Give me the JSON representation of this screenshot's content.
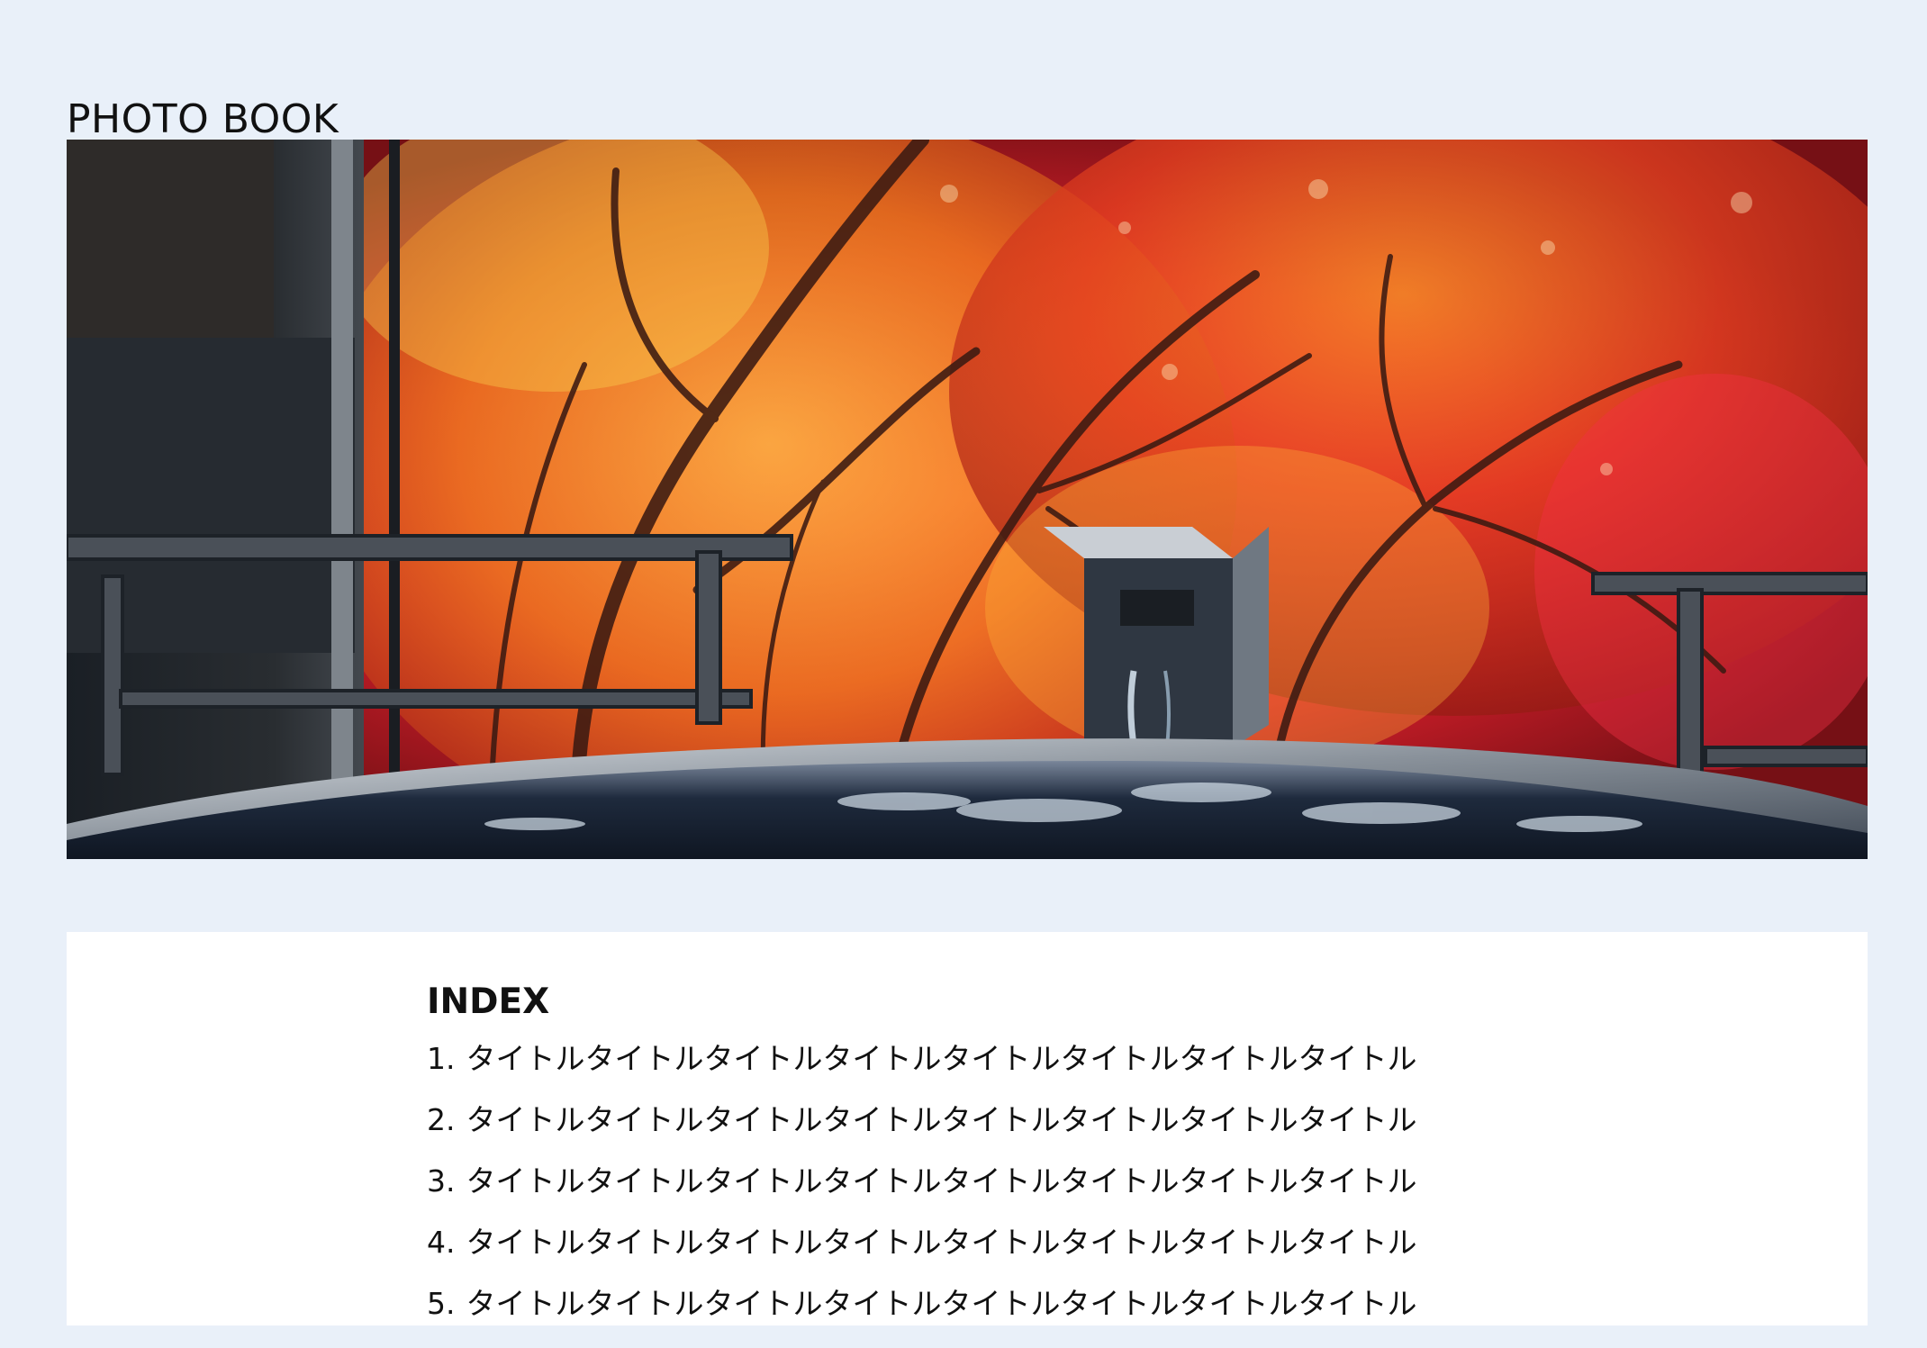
{
  "header": {
    "title": "PHOTO BOOK"
  },
  "hero": {
    "image_name": "autumn-maple-hot-spring-photo"
  },
  "index": {
    "heading": "INDEX",
    "items": [
      {
        "number": "1.",
        "title": "タイトルタイトルタイトルタイトルタイトルタイトルタイトルタイトル"
      },
      {
        "number": "2.",
        "title": "タイトルタイトルタイトルタイトルタイトルタイトルタイトルタイトル"
      },
      {
        "number": "3.",
        "title": "タイトルタイトルタイトルタイトルタイトルタイトルタイトルタイトル"
      },
      {
        "number": "4.",
        "title": "タイトルタイトルタイトルタイトルタイトルタイトルタイトルタイトル"
      },
      {
        "number": "5.",
        "title": "タイトルタイトルタイトルタイトルタイトルタイトルタイトルタイトル"
      }
    ]
  },
  "colors": {
    "page_background": "#e9f0f9",
    "card_background": "#ffffff",
    "text": "#111111",
    "maple_red": "#d51f2b",
    "maple_orange": "#e7731d",
    "water_blue": "#24344a"
  }
}
